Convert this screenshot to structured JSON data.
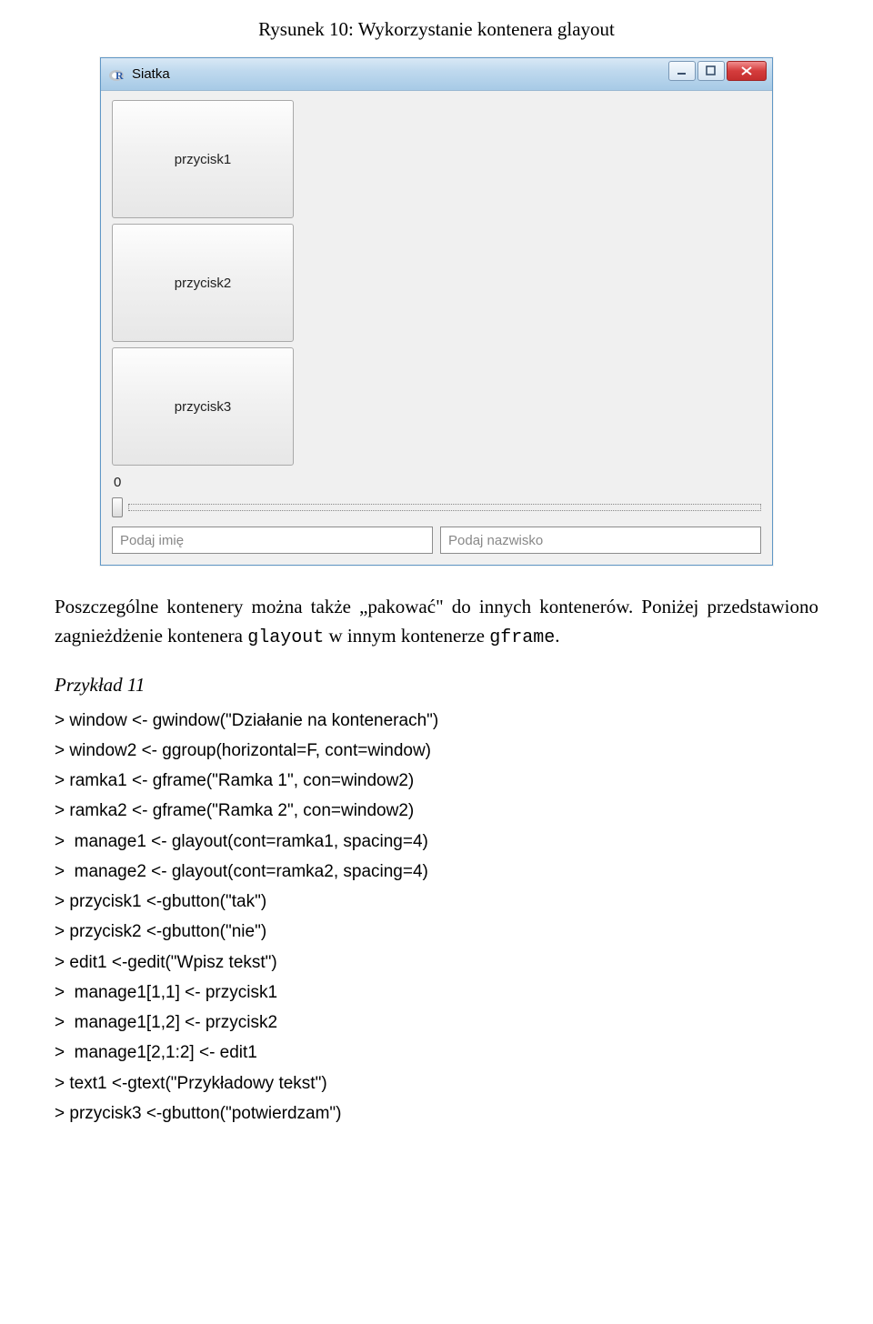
{
  "caption": "Rysunek 10: Wykorzystanie kontenera glayout",
  "window": {
    "title": "Siatka",
    "buttons": [
      "przycisk1",
      "przycisk2",
      "przycisk3"
    ],
    "zero_label": "0",
    "input1_placeholder": "Podaj imię",
    "input2_placeholder": "Podaj nazwisko"
  },
  "body_text_1": "Poszczególne kontenery można także „pakować\" do innych kontenerów. Poniżej przedstawiono zagnieżdżenie kontenera ",
  "body_code_1": "glayout",
  "body_text_2": " w innym kontenerze ",
  "body_code_2": "gframe",
  "body_text_3": ".",
  "example_heading": "Przykład 11",
  "code_lines": [
    "> window <- gwindow(\"Działanie na kontenerach\")",
    "> window2 <- ggroup(horizontal=F, cont=window)",
    "> ramka1 <- gframe(\"Ramka 1\", con=window2)",
    "> ramka2 <- gframe(\"Ramka 2\", con=window2)",
    ">  manage1 <- glayout(cont=ramka1, spacing=4)",
    ">  manage2 <- glayout(cont=ramka2, spacing=4)",
    "> przycisk1 <-gbutton(\"tak\")",
    "> przycisk2 <-gbutton(\"nie\")",
    "> edit1 <-gedit(\"Wpisz tekst\")",
    ">  manage1[1,1] <- przycisk1",
    ">  manage1[1,2] <- przycisk2",
    ">  manage1[2,1:2] <- edit1",
    "> text1 <-gtext(\"Przykładowy tekst\")",
    "> przycisk3 <-gbutton(\"potwierdzam\")"
  ]
}
